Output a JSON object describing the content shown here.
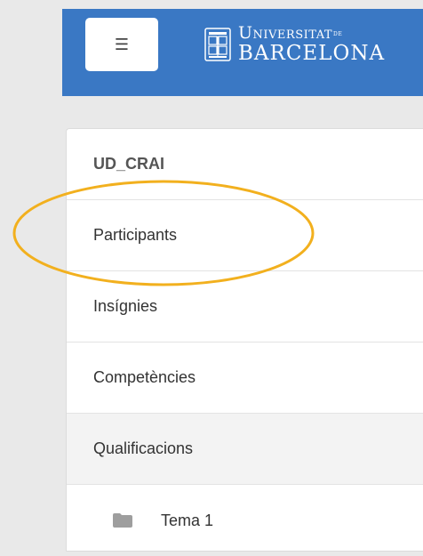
{
  "navbar": {
    "menu_icon": "hamburger-icon",
    "menu_glyph": "☰",
    "logo": {
      "line1": "Universitat",
      "line1_suffix": "de",
      "line2": "BARCELONA",
      "seal_icon": "university-seal-icon"
    },
    "brand_color": "#3a78c4"
  },
  "sidebar": {
    "course_title": "UD_CRAI",
    "items": [
      {
        "label": "Participants"
      },
      {
        "label": "Insígnies"
      },
      {
        "label": "Competències"
      },
      {
        "label": "Qualificacions"
      },
      {
        "label": "Tema 1",
        "icon": "folder-icon"
      }
    ]
  },
  "annotation": {
    "color": "#f2b01e"
  }
}
